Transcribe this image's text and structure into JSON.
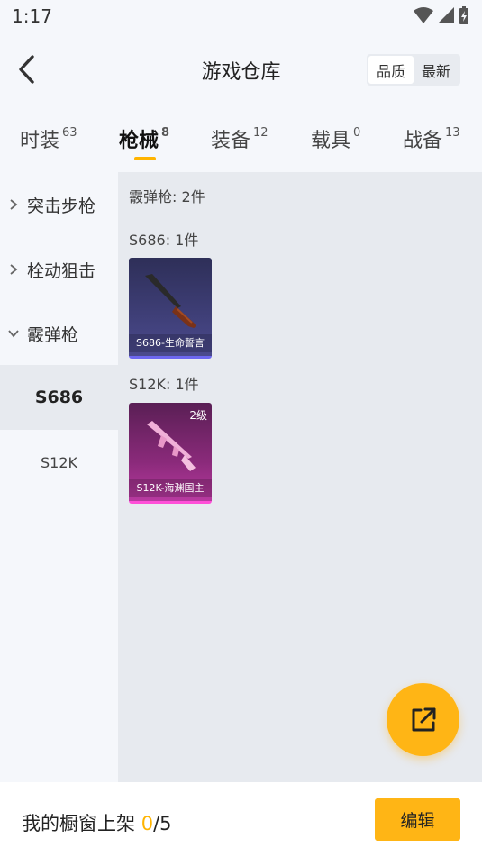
{
  "status": {
    "time": "1:17"
  },
  "header": {
    "title": "游戏仓库",
    "sort_quality": "品质",
    "sort_latest": "最新"
  },
  "tabs": [
    {
      "label": "时装",
      "count": "63"
    },
    {
      "label": "枪械",
      "count": "8"
    },
    {
      "label": "装备",
      "count": "12"
    },
    {
      "label": "载具",
      "count": "0"
    },
    {
      "label": "战备",
      "count": "13"
    }
  ],
  "sidebar": {
    "categories": [
      {
        "label": "突击步枪"
      },
      {
        "label": "栓动狙击"
      },
      {
        "label": "霰弹枪"
      }
    ],
    "subitems": [
      {
        "label": "S686"
      },
      {
        "label": "S12K"
      }
    ]
  },
  "content": {
    "summary": "霰弹枪: 2件",
    "groups": [
      {
        "title": "S686: 1件",
        "item_name": "S686-生命誓言",
        "badge": ""
      },
      {
        "title": "S12K: 1件",
        "item_name": "S12K-海渊国主",
        "badge": "2级"
      }
    ]
  },
  "bottom": {
    "label": "我的橱窗上架 ",
    "count": "0",
    "total": "/5",
    "edit": "编辑"
  },
  "colors": {
    "accent": "#ffb515",
    "blue_rarity": "#6d67f0",
    "pink_rarity": "#ff4fd8"
  }
}
